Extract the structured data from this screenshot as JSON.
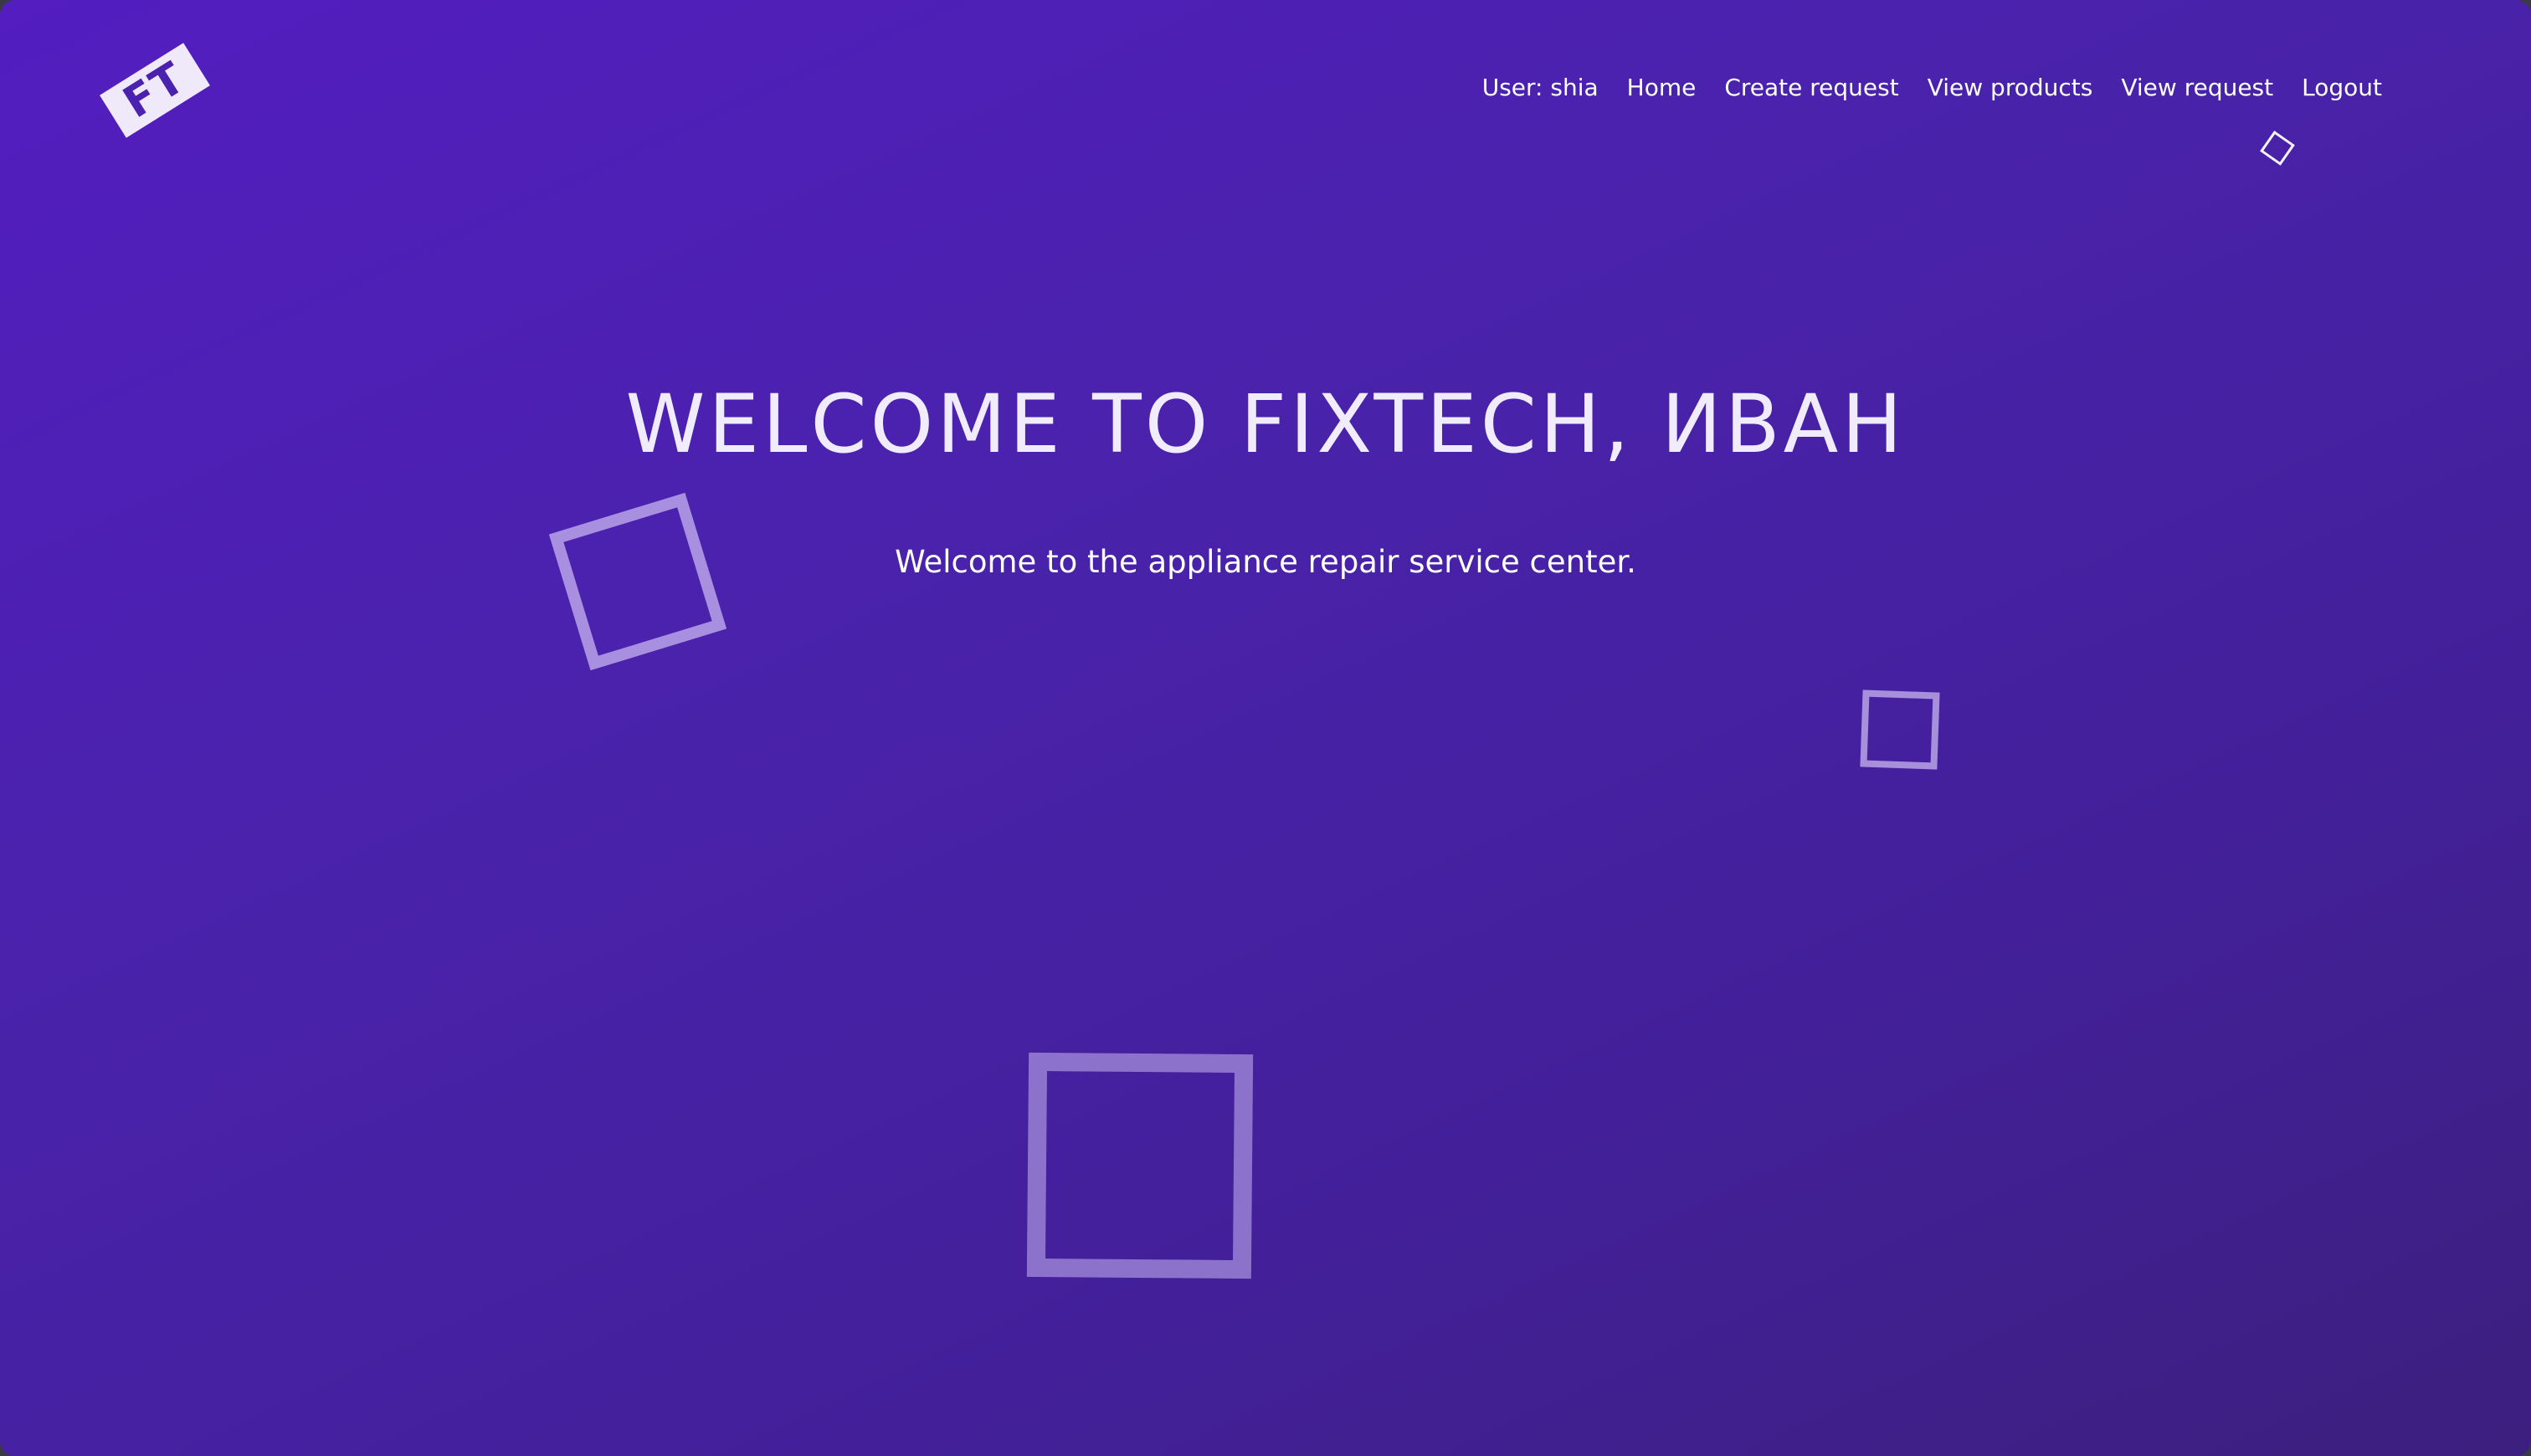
{
  "brand": {
    "logo_text": "FT"
  },
  "nav": {
    "user": "User: shia",
    "items": [
      {
        "label": "Home"
      },
      {
        "label": "Create request"
      },
      {
        "label": "View products"
      },
      {
        "label": "View request"
      },
      {
        "label": "Logout"
      }
    ]
  },
  "hero": {
    "title": "WELCOME TO FIXTECH, ИВАН",
    "subtitle": "Welcome to the appliance repair service center."
  },
  "colors": {
    "background_start": "#531dc0",
    "background_end": "#3c1f7e",
    "logo_bg": "#efe9fa",
    "logo_text": "#4b22b0",
    "title_text": "#f1ecfb"
  }
}
